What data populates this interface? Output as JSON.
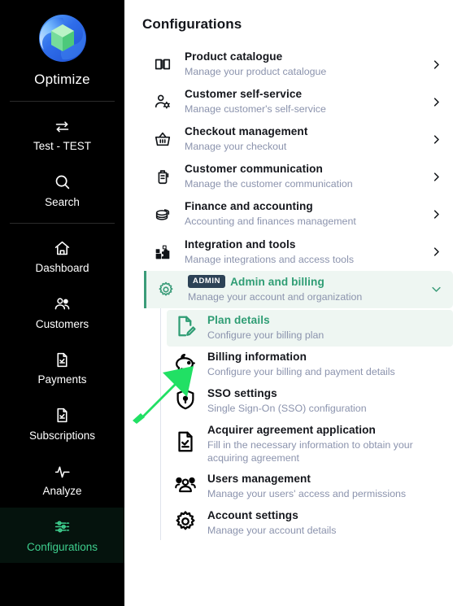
{
  "sidebar": {
    "brand": {
      "name": "Optimize",
      "logo_icon": "optimize-logo-icon"
    },
    "account": {
      "label": "Test - TEST",
      "icon": "switch-arrows-icon"
    },
    "search": {
      "label": "Search",
      "icon": "search-icon"
    },
    "items": [
      {
        "label": "Dashboard",
        "icon": "home-icon",
        "active": false
      },
      {
        "label": "Customers",
        "icon": "users-icon",
        "active": false
      },
      {
        "label": "Payments",
        "icon": "document-icon",
        "active": false
      },
      {
        "label": "Subscriptions",
        "icon": "document-icon",
        "active": false
      },
      {
        "label": "Analyze",
        "icon": "pulse-icon",
        "active": false
      },
      {
        "label": "Configurations",
        "icon": "sliders-icon",
        "active": true
      }
    ]
  },
  "main": {
    "title": "Configurations",
    "rows": [
      {
        "title": "Product catalogue",
        "subtitle": "Manage your product catalogue",
        "icon": "book-icon",
        "chevron": "chevron-right-icon"
      },
      {
        "title": "Customer self-service",
        "subtitle": "Manage customer's self-service",
        "icon": "user-gear-icon",
        "chevron": "chevron-right-icon"
      },
      {
        "title": "Checkout management",
        "subtitle": "Manage your checkout",
        "icon": "basket-icon",
        "chevron": "chevron-right-icon"
      },
      {
        "title": "Customer communication",
        "subtitle": "Manage the customer communication",
        "icon": "megaphone-icon",
        "chevron": "chevron-right-icon"
      },
      {
        "title": "Finance and accounting",
        "subtitle": "Accounting and finances management",
        "icon": "coins-icon",
        "chevron": "chevron-right-icon"
      },
      {
        "title": "Integration and tools",
        "subtitle": "Manage integrations and access tools",
        "icon": "puzzle-icon",
        "chevron": "chevron-right-icon"
      }
    ],
    "admin": {
      "badge": "ADMIN",
      "title": "Admin and billing",
      "subtitle": "Manage your account and organization",
      "icon": "gear-icon",
      "chevron": "chevron-down-icon",
      "expanded": true,
      "subrows": [
        {
          "title": "Plan details",
          "subtitle": "Configure your billing plan",
          "icon": "document-edit-icon",
          "selected": true
        },
        {
          "title": "Billing information",
          "subtitle": "Configure your billing and payment details",
          "icon": "piggy-bank-icon",
          "selected": false
        },
        {
          "title": "SSO settings",
          "subtitle": "Single Sign-On (SSO) configuration",
          "icon": "shield-lock-icon",
          "selected": false
        },
        {
          "title": "Acquirer agreement application",
          "subtitle": "Fill in the necessary information to obtain your acquiring agreement",
          "icon": "document-icon",
          "selected": false
        },
        {
          "title": "Users management",
          "subtitle": "Manage your users' access and permissions",
          "icon": "users-group-icon",
          "selected": false
        },
        {
          "title": "Account settings",
          "subtitle": "Manage your account details",
          "icon": "gear-icon",
          "selected": false
        }
      ]
    }
  },
  "annotation": {
    "arrow_icon": "green-arrow-pointer",
    "color": "#21e064"
  },
  "colors": {
    "sidebar_bg": "#000000",
    "sidebar_active_bg": "#05130d",
    "accent_green": "#3ecf8e",
    "admin_green": "#2f9d74",
    "admin_row_bg": "#eef6f2",
    "badge_bg": "#2c4256",
    "subtitle": "#8b93ad",
    "title": "#14161c"
  }
}
